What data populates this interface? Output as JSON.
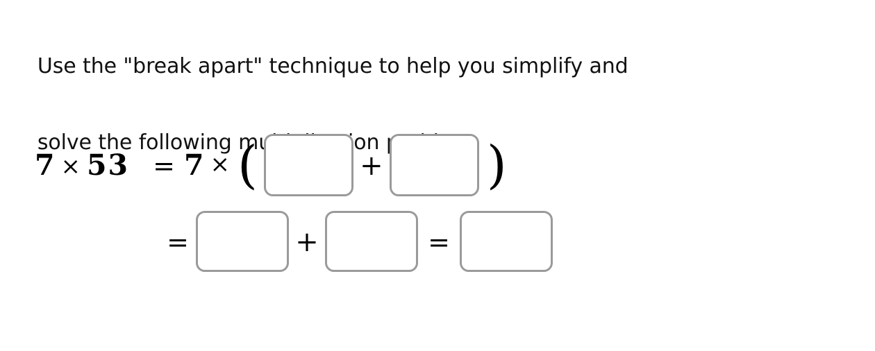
{
  "page": {
    "background_color": "#ffffff",
    "text_color": "#111111"
  },
  "prompt": {
    "line_1": "Use the \"break apart\" technique to help you simplify and",
    "line_2": "solve the following multiplication problem.",
    "full_text": "Use the \"break apart\" technique to help you simplify and solve the following multiplication problem."
  },
  "problem": {
    "expression": "7 × 53",
    "factor": "7",
    "product_operand": "53",
    "row1": {
      "lhs_first_factor": "7",
      "lhs_times": "×",
      "lhs_second_factor": "53",
      "equals": "=",
      "rhs_factor": "7",
      "rhs_times": "×",
      "paren_open": "(",
      "plus": "+",
      "paren_close": ")",
      "box_1_value": "",
      "box_1_placeholder": "",
      "box_2_value": "",
      "box_2_placeholder": ""
    },
    "row2": {
      "equals_1": "=",
      "box_1_value": "",
      "box_1_placeholder": "",
      "plus": "+",
      "box_2_value": "",
      "box_2_placeholder": "",
      "equals_2": "=",
      "box_3_value": "",
      "box_3_placeholder": ""
    }
  },
  "style": {
    "box_border_color": "#9a9a9a",
    "box_fill_color": "#ffffff",
    "math_text_color": "#000000"
  }
}
